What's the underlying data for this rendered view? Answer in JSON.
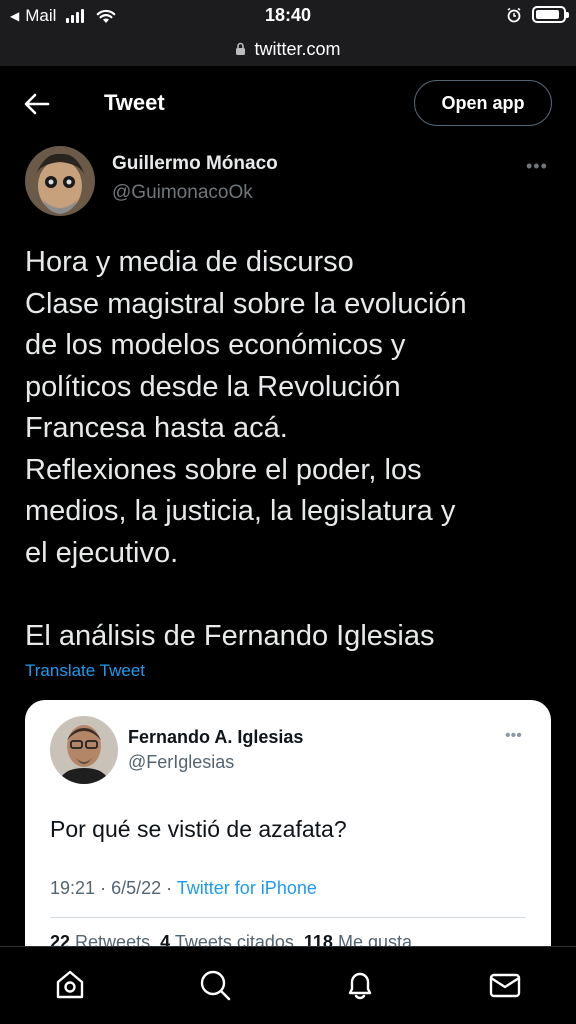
{
  "status_bar": {
    "back_app": "Mail",
    "time": "18:40",
    "battery_level": 0.9
  },
  "url_bar": {
    "url": "twitter.com"
  },
  "header": {
    "title": "Tweet",
    "open_app_label": "Open app"
  },
  "tweet": {
    "author_name": "Guillermo Mónaco",
    "author_handle": "@GuimonacoOk",
    "text_lines": [
      "Hora y media de discurso",
      "Clase magistral sobre la evolución",
      "de los modelos económicos y",
      "políticos desde la Revolución",
      "Francesa hasta acá.",
      "Reflexiones sobre el poder, los",
      "medios, la justicia, la legislatura y",
      "el ejecutivo.",
      "",
      "El análisis de Fernando Iglesias"
    ],
    "translate_label": "Translate Tweet"
  },
  "quoted": {
    "author_name": "Fernando A. Iglesias",
    "author_handle": "@FerIglesias",
    "text": "Por qué se vistió de azafata?",
    "time": "19:21",
    "date": "6/5/22",
    "source": "Twitter for iPhone",
    "retweets_count": "22",
    "retweets_label": "Retweets",
    "quotes_count": "4",
    "quotes_label": "Tweets citados",
    "likes_count": "118",
    "likes_label": "Me gusta"
  },
  "nav": [
    "home-icon",
    "search-icon",
    "notifications-icon",
    "messages-icon"
  ],
  "colors": {
    "accent": "#1d9bf0",
    "background": "#000000",
    "secondary_text": "#71767b"
  }
}
